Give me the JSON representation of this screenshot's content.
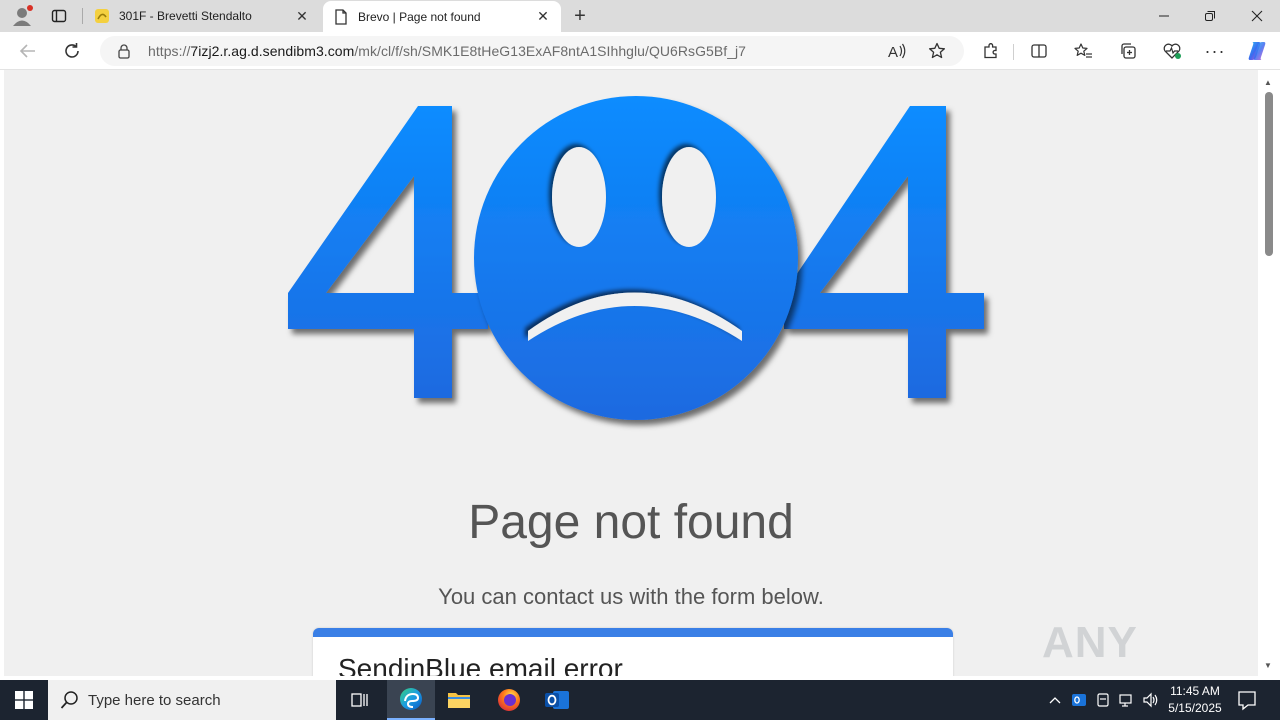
{
  "browser": {
    "tabs": [
      {
        "title": "301F - Brevetti Stendalto",
        "active": false
      },
      {
        "title": "Brevo | Page not found",
        "active": true
      }
    ],
    "url": {
      "scheme": "https://",
      "host": "7izj2.r.ag.d.sendibm3.com",
      "path": "/mk/cl/f/sh/SMK1E8tHeG13ExAF8ntA1SIhhglu/QU6RsG5Bf_j7"
    },
    "accent": "#1a73e8"
  },
  "page": {
    "error_code": "404",
    "title": "Page not found",
    "subtitle": "You can contact us with the form below.",
    "form_card_title": "SendinBlue email error",
    "colors": {
      "primary": "#0a84ff",
      "card_accent": "#3a7fe6",
      "text": "#555555"
    }
  },
  "watermark": {
    "text": "ANY RUN"
  },
  "taskbar": {
    "search_placeholder": "Type here to search",
    "time": "11:45 AM",
    "date": "5/15/2025"
  }
}
